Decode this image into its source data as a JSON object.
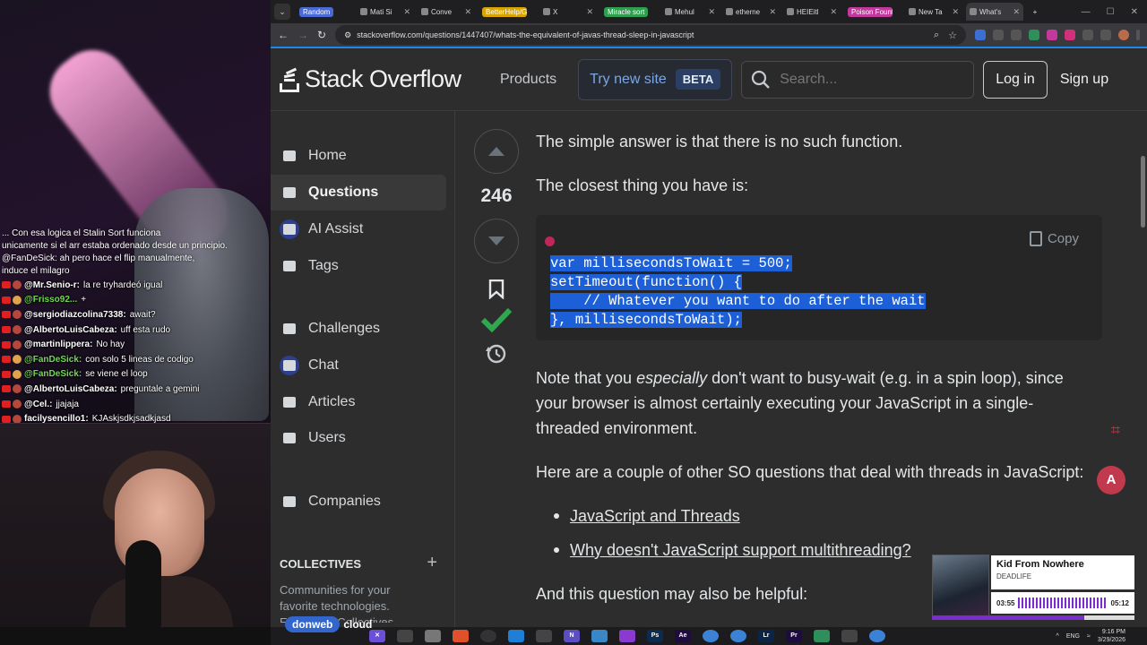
{
  "stream": {
    "chat_pre": [
      "... Con esa logica el Stalin Sort funciona",
      "unicamente si el arr estaba ordenado desde un principio.",
      "@FanDeSick: ah pero hace el flip manualmente,",
      "induce el milagro"
    ],
    "chat": [
      {
        "user": "@Mr.Senio-r:",
        "msg": "la re tryhardeó igual",
        "green": false
      },
      {
        "user": "@Frisso92...",
        "msg": "+",
        "green": true
      },
      {
        "user": "@sergiodiazcolina7338:",
        "msg": "await?",
        "green": false
      },
      {
        "user": "@AlbertoLuisCabeza:",
        "msg": "uff esta rudo",
        "green": false
      },
      {
        "user": "@martinlippera:",
        "msg": "No hay",
        "green": false
      },
      {
        "user": "@FanDeSick:",
        "msg": "con solo 5 lineas de codigo",
        "green": true
      },
      {
        "user": "@FanDeSick:",
        "msg": "se viene el loop",
        "green": true
      },
      {
        "user": "@AlbertoLuisCabeza:",
        "msg": "preguntale a gemini",
        "green": false
      },
      {
        "user": "@Cel.:",
        "msg": "jjajaja",
        "green": false
      },
      {
        "user": "facilysencillo1:",
        "msg": "KJAskjsdkjsadkjasd",
        "green": false
      }
    ],
    "sponsor": "donweb",
    "sponsor_suffix": "cloud"
  },
  "tabs": [
    {
      "label": "Random",
      "pill": "#4a6bd6"
    },
    {
      "label": "Mati Si",
      "pill": ""
    },
    {
      "label": "Conve",
      "pill": ""
    },
    {
      "label": "BetterHelp/Google m",
      "pill": "#d9a400"
    },
    {
      "label": "X",
      "pill": ""
    },
    {
      "label": "Miracle sort",
      "pill": "#2e9e4f"
    },
    {
      "label": "Mehul",
      "pill": ""
    },
    {
      "label": "etherne",
      "pill": ""
    },
    {
      "label": "HEIEitl",
      "pill": ""
    },
    {
      "label": "Poison Fountain",
      "pill": "#c2389d"
    },
    {
      "label": "New Ta",
      "pill": ""
    },
    {
      "label": "What's",
      "pill": "",
      "active": true
    }
  ],
  "address": {
    "url": "stackoverflow.com/questions/1447407/whats-the-equivalent-of-javas-thread-sleep-in-javascript"
  },
  "header": {
    "logo_text": "Stack Overflow",
    "products": "Products",
    "try_new": "Try new site",
    "beta": "BETA",
    "search_placeholder": "Search...",
    "login": "Log in",
    "signup": "Sign up"
  },
  "nav": {
    "items": [
      {
        "label": "Home",
        "icon": "home-icon"
      },
      {
        "label": "Questions",
        "icon": "questions-icon",
        "active": true
      },
      {
        "label": "AI Assist",
        "icon": "ai-assist-icon"
      },
      {
        "label": "Tags",
        "icon": "tag-icon"
      },
      {
        "label": "Challenges",
        "icon": "challenges-icon"
      },
      {
        "label": "Chat",
        "icon": "chat-icon"
      },
      {
        "label": "Articles",
        "icon": "articles-icon"
      },
      {
        "label": "Users",
        "icon": "users-icon"
      },
      {
        "label": "Companies",
        "icon": "companies-icon"
      }
    ],
    "collectives_title": "COLLECTIVES",
    "collectives_desc": "Communities for your favorite technologies.",
    "collectives_more": "Explore all Collectives"
  },
  "answer": {
    "score": "246",
    "p1": "The simple answer is that there is no such function.",
    "p2": "The closest thing you have is:",
    "copy_label": "Copy",
    "code": [
      "var millisecondsToWait = 500;",
      "setTimeout(function() {",
      "    // Whatever you want to do after the wait",
      "}, millisecondsToWait);"
    ],
    "p3_pre": "Note that you ",
    "p3_em": "especially",
    "p3_post": " don't want to busy-wait (e.g. in a spin loop), since your browser is almost certainly executing your JavaScript in a single-threaded environment.",
    "p4": "Here are a couple of other SO questions that deal with threads in JavaScript:",
    "links": [
      "JavaScript and Threads",
      "Why doesn't JavaScript support multithreading?"
    ],
    "p5": "And this question may also be helpful:"
  },
  "player": {
    "title": "Kid From Nowhere",
    "artist": "DEADLIFE",
    "elapsed": "03:55",
    "total": "05:12",
    "progress": 0.75
  },
  "tray": {
    "lang": "ENG",
    "time": "9:16 PM",
    "date": "3/29/2026"
  }
}
